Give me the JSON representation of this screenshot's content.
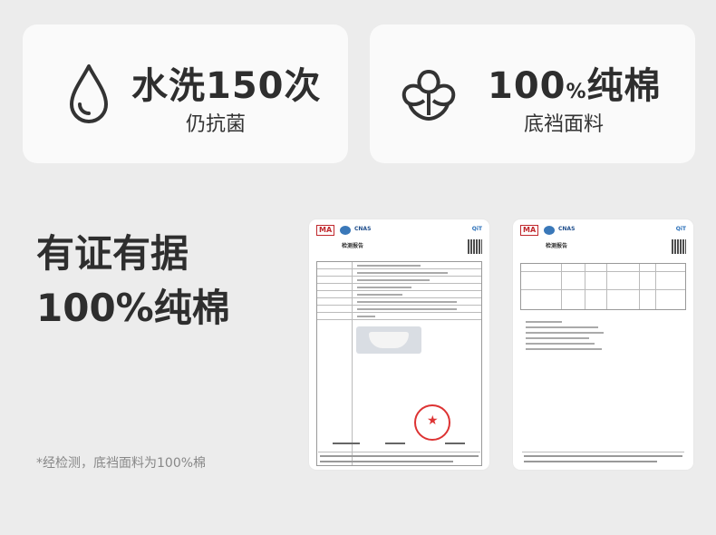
{
  "features": [
    {
      "icon": "water-drop-icon",
      "title": "水洗150次",
      "subtitle": "仍抗菌"
    },
    {
      "icon": "cotton-flower-icon",
      "title_num": "100",
      "title_pct": "%",
      "title_text": "纯棉",
      "subtitle": "底裆面料"
    }
  ],
  "headline": {
    "line1": "有证有据",
    "line2": "100%纯棉"
  },
  "footnote": "*经检测，底裆面料为100%棉",
  "documents": [
    {
      "title": "检测报告",
      "stamp_color": "#d33333"
    },
    {
      "title": "检测报告"
    }
  ],
  "colors": {
    "background": "#ececec",
    "card": "#fafafa",
    "text": "#2e2e2e",
    "stamp": "#d33333"
  }
}
